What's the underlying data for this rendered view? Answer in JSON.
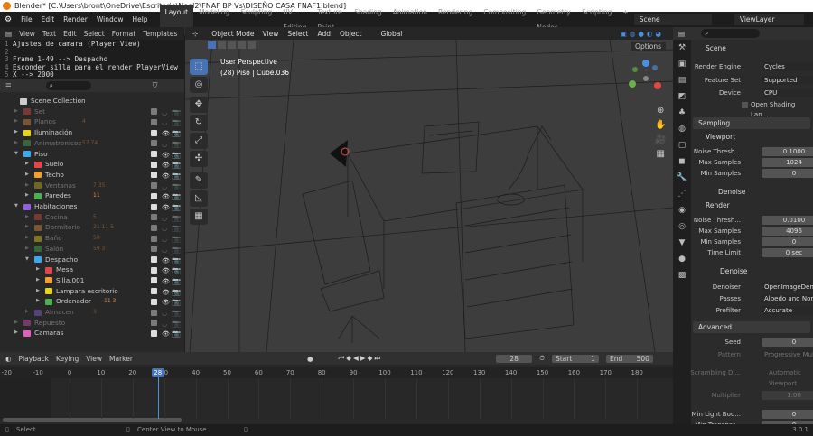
{
  "window": {
    "title": "Blender* [C:\\Users\\bront\\OneDrive\\Escritorio\\Noel2\\FNAF BP Vs\\DISEÑO CASA FNAF1.blend]"
  },
  "menus": [
    "File",
    "Edit",
    "Render",
    "Window",
    "Help"
  ],
  "workspaces": [
    "Layout",
    "Modeling",
    "Sculpting",
    "UV Editing",
    "Texture Paint",
    "Shading",
    "Animation",
    "Rendering",
    "Compositing",
    "Geometry Nodes",
    "Scripting",
    "+"
  ],
  "scene": "Scene",
  "view_layer": "ViewLayer",
  "text_editor": {
    "menus": [
      "View",
      "Text",
      "Edit",
      "Select",
      "Format",
      "Templates"
    ],
    "lines": [
      {
        "n": "1",
        "t": "Ajustes de camara (Player View)"
      },
      {
        "n": "2",
        "t": ""
      },
      {
        "n": "3",
        "t": "Frame 1-49 --> Despacho"
      },
      {
        "n": "4",
        "t": "Esconder silla para el render PlayerView"
      },
      {
        "n": "5",
        "t": "X --> 2000"
      }
    ]
  },
  "outliner": {
    "rows": [
      {
        "name": "Scene Collection",
        "depth": 0,
        "color": "#cccccc",
        "vis": true,
        "root": true
      },
      {
        "name": "Set",
        "depth": 1,
        "color": "#e04848",
        "vis": false
      },
      {
        "name": "Planos",
        "depth": 1,
        "color": "#e08a3c",
        "vis": false,
        "badge": "4"
      },
      {
        "name": "Iluminación",
        "depth": 1,
        "color": "#e8d21c",
        "vis": true
      },
      {
        "name": "Animatronicos",
        "depth": 1,
        "color": "#4caf50",
        "vis": false,
        "badge": "57  74"
      },
      {
        "name": "Piso",
        "depth": 1,
        "color": "#3fa7f0",
        "vis": true,
        "open": true
      },
      {
        "name": "Suelo",
        "depth": 2,
        "color": "#e04848",
        "vis": true
      },
      {
        "name": "Techo",
        "depth": 2,
        "color": "#f0a030",
        "vis": true
      },
      {
        "name": "Ventanas",
        "depth": 2,
        "color": "#c8b418",
        "vis": false,
        "badge": "7  35"
      },
      {
        "name": "Paredes",
        "depth": 2,
        "color": "#4caf50",
        "vis": true,
        "badge": "11"
      },
      {
        "name": "Habitaciones",
        "depth": 1,
        "color": "#9060e0",
        "vis": true,
        "open": true
      },
      {
        "name": "Cocina",
        "depth": 2,
        "color": "#e04848",
        "vis": false,
        "badge": "5"
      },
      {
        "name": "Dormitorio",
        "depth": 2,
        "color": "#e08a3c",
        "vis": false,
        "badge": "21  11  5"
      },
      {
        "name": "Baño",
        "depth": 2,
        "color": "#e8d21c",
        "vis": false,
        "badge": "50"
      },
      {
        "name": "Salón",
        "depth": 2,
        "color": "#4caf50",
        "vis": false,
        "badge": "59  3"
      },
      {
        "name": "Despacho",
        "depth": 2,
        "color": "#3fa7f0",
        "vis": true,
        "open": true
      },
      {
        "name": "Mesa",
        "depth": 3,
        "color": "#e04848",
        "vis": true
      },
      {
        "name": "Silla.001",
        "depth": 3,
        "color": "#f0a030",
        "vis": true
      },
      {
        "name": "Lampara escritorio",
        "depth": 3,
        "color": "#e8d21c",
        "vis": true
      },
      {
        "name": "Ordenador",
        "depth": 3,
        "color": "#4caf50",
        "vis": true,
        "badge": "11  3"
      },
      {
        "name": "Almacen",
        "depth": 2,
        "color": "#9060e0",
        "vis": false,
        "badge": "3"
      },
      {
        "name": "Repuesto",
        "depth": 1,
        "color": "#d050c0",
        "vis": false
      },
      {
        "name": "Camaras",
        "depth": 1,
        "color": "#e060c0",
        "vis": true
      }
    ]
  },
  "viewport": {
    "mode": "Object Mode",
    "menus": [
      "View",
      "Select",
      "Add",
      "Object"
    ],
    "transform": "Global",
    "options": "Options",
    "view_name": "User Perspective",
    "object_info": "(28) Piso | Cube.036"
  },
  "properties": {
    "title": "Scene",
    "rows": [
      {
        "label": "Render Engine",
        "value": "Cycles",
        "dd": true
      },
      {
        "label": "Feature Set",
        "value": "Supported",
        "dd": true
      },
      {
        "label": "Device",
        "value": "CPU",
        "dd": true
      },
      {
        "label": "",
        "value": "Open Shading Lan...",
        "check": true
      }
    ],
    "sampling": "Sampling",
    "viewport": "Viewport",
    "vp_rows": [
      {
        "label": "Noise Thresh...",
        "value": "0.1000"
      },
      {
        "label": "Max Samples",
        "value": "1024"
      },
      {
        "label": "Min Samples",
        "value": "0"
      }
    ],
    "denoise": "Denoise",
    "render": "Render",
    "r_rows": [
      {
        "label": "Noise Thresh...",
        "value": "0.0100"
      },
      {
        "label": "Max Samples",
        "value": "4096"
      },
      {
        "label": "Min Samples",
        "value": "0"
      },
      {
        "label": "Time Limit",
        "value": "0 sec"
      }
    ],
    "d_rows": [
      {
        "label": "Denoiser",
        "value": "OpenImageDenoi..."
      },
      {
        "label": "Passes",
        "value": "Albedo and Normal"
      },
      {
        "label": "Prefilter",
        "value": "Accurate"
      }
    ],
    "advanced": "Advanced",
    "seed": {
      "label": "Seed",
      "value": "0"
    },
    "pattern": {
      "label": "Pattern",
      "value": "Progressive Multi-..."
    },
    "scrambling": {
      "label": "Scrambling Di...",
      "auto": "Automatic",
      "viewport": "Viewport"
    },
    "multiplier": {
      "label": "Multiplier",
      "value": "1.00"
    },
    "min_light": {
      "label": "Min Light Bou...",
      "value": "0"
    },
    "min_transp": {
      "label": "Min Transpar...",
      "value": "0"
    }
  },
  "timeline": {
    "menus": [
      "Playback",
      "Keying",
      "View",
      "Marker"
    ],
    "current_frame": "28",
    "start_label": "Start",
    "start": "1",
    "end_label": "End",
    "end": "500",
    "ticks": [
      "-20",
      "-10",
      "0",
      "10",
      "20",
      "30",
      "40",
      "50",
      "60",
      "70",
      "80",
      "90",
      "100",
      "110",
      "120",
      "130",
      "140",
      "150",
      "160",
      "170",
      "180"
    ]
  },
  "status": {
    "select": "Select",
    "center": "Center View to Mouse",
    "version": "3.0.1"
  }
}
